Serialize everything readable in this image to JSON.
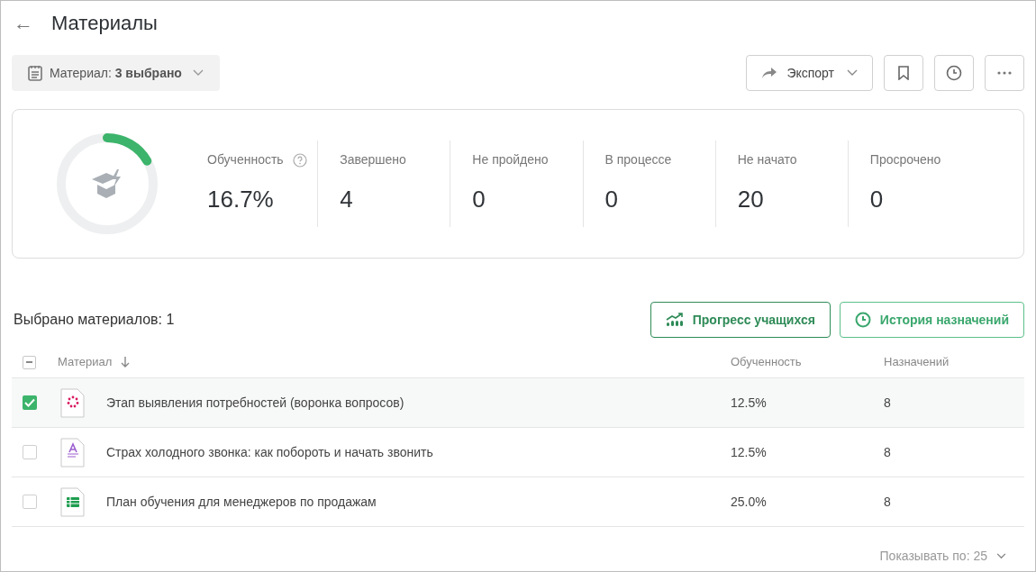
{
  "header": {
    "back": "←",
    "title": "Материалы"
  },
  "filter": {
    "label": "Материал: **3 выбрано**"
  },
  "toolbar": {
    "export": "Экспорт"
  },
  "stats": {
    "progress_ring": {
      "level": 0.167
    },
    "items": [
      {
        "label": "Обученность",
        "value": "16.7%",
        "help": true
      },
      {
        "label": "Завершено",
        "value": "4",
        "help": false
      },
      {
        "label": "Не пройдено",
        "value": "0",
        "help": false
      },
      {
        "label": "В процессе",
        "value": "0",
        "help": false
      },
      {
        "label": "Не начато",
        "value": "20",
        "help": false
      },
      {
        "label": "Просрочено",
        "value": "0",
        "help": false
      }
    ]
  },
  "section": {
    "title": "Выбрано материалов: 1",
    "buttons": [
      {
        "kind": "progress",
        "label": "Прогресс учащихся"
      },
      {
        "kind": "history",
        "label": "История назначений"
      }
    ]
  },
  "table": {
    "select_all": {
      "indeterminate": true
    },
    "columns": [
      "Материал",
      "Обученность",
      "Назначений"
    ],
    "rows": [
      {
        "kind": "quiz",
        "checked": true,
        "name": "Этап выявления потребностей (воронка вопросов)",
        "progress": "12.5%",
        "assignments": "8"
      },
      {
        "kind": "text",
        "checked": false,
        "name": "Страх холодного звонка: как побороть и начать звонить",
        "progress": "12.5%",
        "assignments": "8"
      },
      {
        "kind": "sheet",
        "checked": false,
        "name": "План обучения для менеджеров по продажам",
        "progress": "25.0%",
        "assignments": "8"
      }
    ]
  },
  "pagination": {
    "label": "Показывать по: 25"
  }
}
